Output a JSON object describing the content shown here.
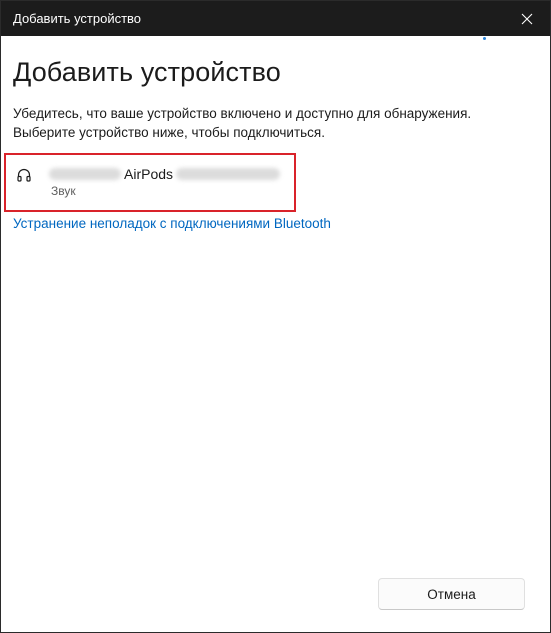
{
  "window": {
    "title": "Добавить устройство"
  },
  "heading": "Добавить устройство",
  "description": {
    "line1": "Убедитесь, что ваше устройство включено и доступно для обнаружения.",
    "line2": "Выберите устройство ниже, чтобы подключиться."
  },
  "devices": [
    {
      "name": "AirPods",
      "type": "Звук",
      "icon": "headphones-icon"
    }
  ],
  "troubleshoot_link": "Устранение неполадок с подключениями Bluetooth",
  "buttons": {
    "cancel": "Отмена"
  },
  "colors": {
    "titlebar": "#1c1c1c",
    "accent_link": "#0067c0",
    "highlight_border": "#d9232a"
  }
}
